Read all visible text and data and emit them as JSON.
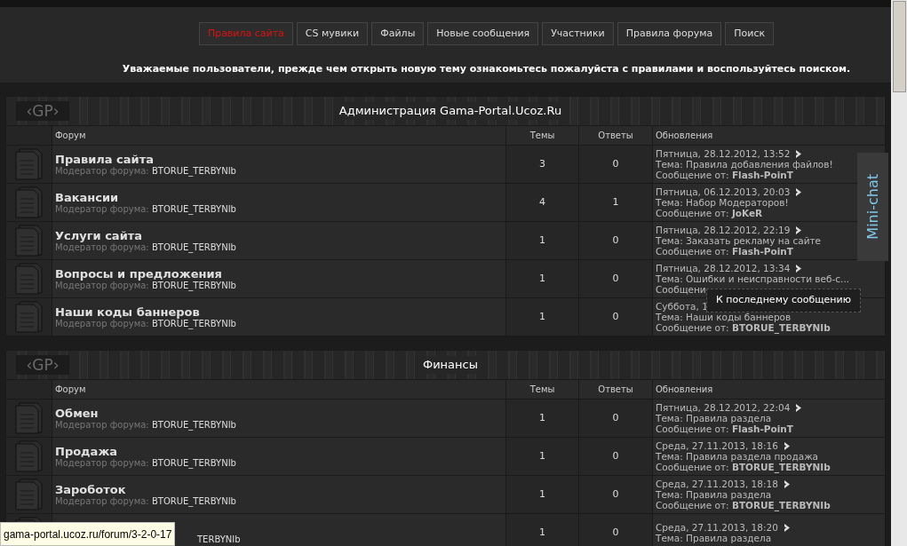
{
  "nav": [
    {
      "label": "Правила сайта",
      "selected": true
    },
    {
      "label": "CS мувики",
      "selected": false
    },
    {
      "label": "Файлы",
      "selected": false
    },
    {
      "label": "Новые сообщения",
      "selected": false
    },
    {
      "label": "Участники",
      "selected": false
    },
    {
      "label": "Правила форума",
      "selected": false
    },
    {
      "label": "Поиск",
      "selected": false
    }
  ],
  "notice": "Уважаемые пользователи, прежде чем открыть новую тему ознакомьтесь пожалуйста с правилами и воспользуйтесь поиском.",
  "sections": [
    {
      "logo": "‹GP›",
      "title": "Администрация Gama-Portal.Ucoz.Ru",
      "columns": [
        "Форум",
        "Темы",
        "Ответы",
        "Обновления"
      ],
      "forums": [
        {
          "name": "Правила сайта",
          "moderator_label": "Модератор форума:",
          "moderator": "BTORUE_TERBYNIb",
          "topics": "3",
          "replies": "0",
          "date": "Пятница, 28.12.2012, 13:52",
          "topic": "Тема: Правила добавления файлов!",
          "author_line": "Сообщение от: **Flash-PoinT**"
        },
        {
          "name": "Вакансии",
          "moderator_label": "Модератор форума:",
          "moderator": "BTORUE_TERBYNIb",
          "topics": "4",
          "replies": "1",
          "date": "Пятница, 06.12.2013, 20:03",
          "topic": "Тема: Набор Модераторов!",
          "author_line": "Сообщение от: **JoKeR**"
        },
        {
          "name": "Услуги сайта",
          "moderator_label": "Модератор форума:",
          "moderator": "BTORUE_TERBYNIb",
          "topics": "1",
          "replies": "0",
          "date": "Пятница, 28.12.2012, 22:19",
          "topic": "Тема: Заказать рекламу на сайте",
          "author_line": "Сообщение от: **Flash-PoinT**"
        },
        {
          "name": "Вопросы и предложения",
          "moderator_label": "Модератор форума:",
          "moderator": "BTORUE_TERBYNIb",
          "topics": "1",
          "replies": "0",
          "date": "Пятница, 28.12.2012, 13:34",
          "topic": "Тема: Ошибки и неисправности веб-с...",
          "author_line": "Сообщени"
        },
        {
          "name": "Наши коды баннеров",
          "moderator_label": "Модератор форума:",
          "moderator": "BTORUE_TERBYNIb",
          "topics": "1",
          "replies": "0",
          "date": "Суббота, 1",
          "topic": "Тема: Наши коды баннеров",
          "author_line": "Сообщение от: **BTORUE_TERBYNIb**"
        }
      ]
    },
    {
      "logo": "‹GP›",
      "title": "Финансы",
      "columns": [
        "Форум",
        "Темы",
        "Ответы",
        "Обновления"
      ],
      "forums": [
        {
          "name": "Обмен",
          "moderator_label": "Модератор форума:",
          "moderator": "BTORUE_TERBYNIb",
          "topics": "1",
          "replies": "0",
          "date": "Пятница, 28.12.2012, 22:04",
          "topic": "Тема: Правила раздела",
          "author_line": "Сообщение от: **Flash-PoinT**"
        },
        {
          "name": "Продажа",
          "moderator_label": "Модератор форума:",
          "moderator": "BTORUE_TERBYNIb",
          "topics": "1",
          "replies": "0",
          "date": "Среда, 27.11.2013, 18:16",
          "topic": "Тема: Правила раздела продажа",
          "author_line": "Сообщение от: **BTORUE_TERBYNIb**"
        },
        {
          "name": "Зароботок",
          "moderator_label": "Модератор форума:",
          "moderator": "BTORUE_TERBYNIb",
          "topics": "1",
          "replies": "0",
          "date": "Среда, 27.11.2013, 18:18",
          "topic": "Тема: Правила раздела",
          "author_line": "Сообщение от: **BTORUE_TERBYNIb**"
        },
        {
          "moderator": "TERBYNIb",
          "topics": "1",
          "replies": "0",
          "date": "Среда, 27.11.2013, 18:20",
          "topic": "Тема: Правила раздела"
        }
      ]
    }
  ],
  "tooltip": "К последнему сообщению",
  "mini_chat": "Mini-chat",
  "status_bar": "gama-portal.ucoz.ru/forum/3-2-0-17"
}
